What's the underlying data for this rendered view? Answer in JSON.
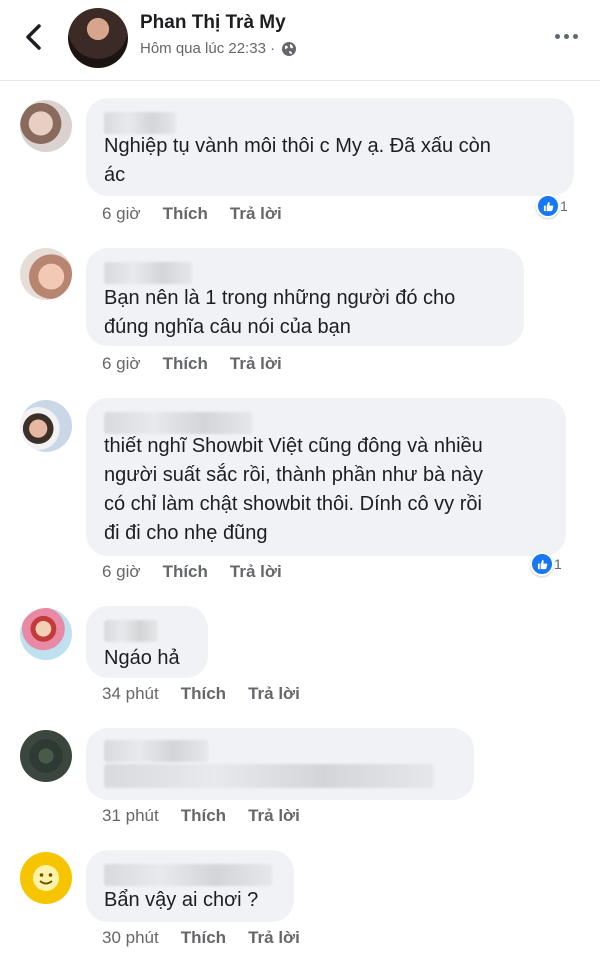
{
  "header": {
    "author": "Phan Thị Trà My",
    "time": "Hôm qua lúc 22:33 ·"
  },
  "actions": {
    "like": "Thích",
    "reply": "Trả lời"
  },
  "comments": [
    {
      "text": "Nghiệp tụ vành môi thôi c My ạ. Đã xấu còn\nác",
      "time": "6 giờ",
      "reactions": "1"
    },
    {
      "text": "Bạn nên là 1 trong những người đó cho\nđúng nghĩa câu nói của bạn",
      "time": "6 giờ"
    },
    {
      "text": "thiết nghĩ Showbit Việt cũng đông và nhiều\nngười suất sắc rồi, thành phần như bà này\ncó chỉ làm chật showbit thôi. Dính cô vy rồi\nđi đi cho nhẹ đũng",
      "time": "6 giờ",
      "reactions": "1"
    },
    {
      "text": "Ngáo hả",
      "time": "34 phút"
    },
    {
      "text": "",
      "time": "31 phút"
    },
    {
      "text": "Bẩn vậy ai chơi ?",
      "time": "30 phút"
    }
  ],
  "colors": {
    "accent": "#1877f2",
    "bubble": "#f0f2f5",
    "meta": "#65676b"
  }
}
